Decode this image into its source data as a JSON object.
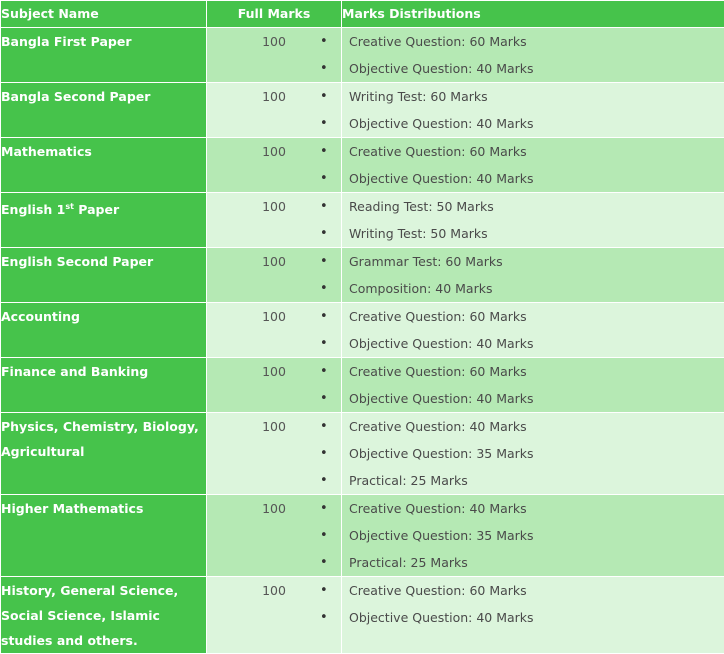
{
  "headers": {
    "subject": "Subject Name",
    "full": "Full Marks",
    "dist": "Marks Distributions"
  },
  "rows": [
    {
      "subject": "Bangla First Paper",
      "full": "100",
      "dist": [
        "Creative Question: 60 Marks",
        "Objective Question: 40 Marks"
      ]
    },
    {
      "subject": "Bangla Second Paper",
      "full": "100",
      "dist": [
        "Writing Test: 60 Marks",
        "Objective Question: 40 Marks"
      ]
    },
    {
      "subject": "Mathematics",
      "full": "100",
      "dist": [
        "Creative Question: 60 Marks",
        "Objective Question: 40 Marks"
      ]
    },
    {
      "subject_prefix": "English 1",
      "subject_sup": "st",
      "subject_suffix": " Paper",
      "full": "100",
      "dist": [
        "Reading Test: 50 Marks",
        "Writing Test: 50 Marks"
      ]
    },
    {
      "subject": "English Second Paper",
      "full": "100",
      "dist": [
        "Grammar Test: 60 Marks",
        "Composition: 40 Marks"
      ]
    },
    {
      "subject": "Accounting",
      "full": "100",
      "dist": [
        "Creative Question: 60 Marks",
        "Objective Question: 40 Marks"
      ]
    },
    {
      "subject": "Finance and Banking",
      "full": "100",
      "dist": [
        "Creative Question: 60 Marks",
        "Objective Question: 40 Marks"
      ]
    },
    {
      "subject": "Physics, Chemistry, Biology, Agricultural",
      "full": "100",
      "dist": [
        "Creative Question: 40 Marks",
        "Objective Question: 35 Marks",
        "Practical: 25 Marks"
      ]
    },
    {
      "subject": "Higher Mathematics",
      "full": "100",
      "dist": [
        "Creative Question: 40 Marks",
        "Objective Question: 35 Marks",
        "Practical: 25 Marks"
      ]
    },
    {
      "subject": "History, General Science, Social Science, Islamic studies and others.",
      "full": "100",
      "dist": [
        "Creative Question: 60 Marks",
        "Objective Question: 40 Marks"
      ]
    }
  ]
}
